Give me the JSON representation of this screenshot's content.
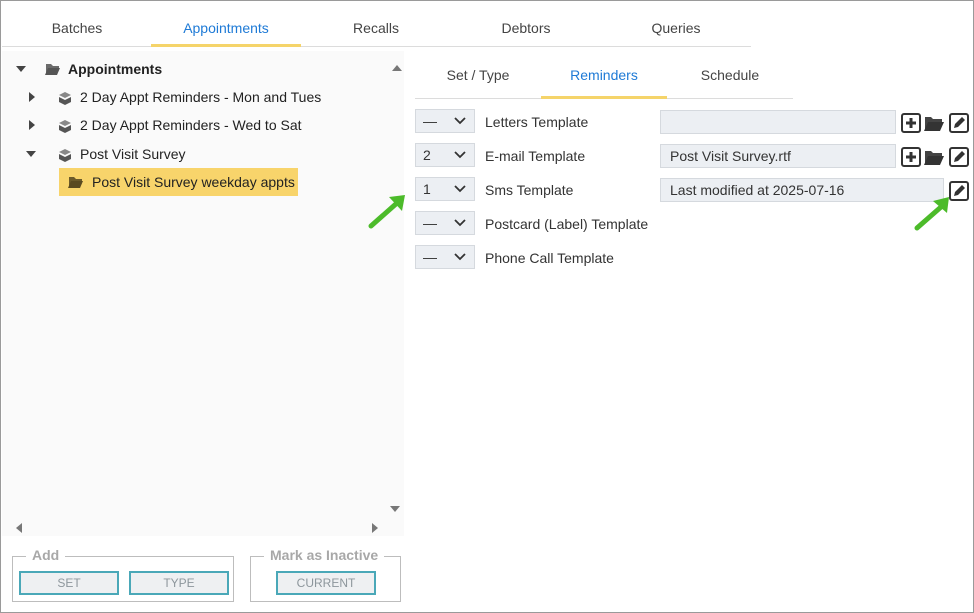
{
  "top_tabs": [
    "Batches",
    "Appointments",
    "Recalls",
    "Debtors",
    "Queries"
  ],
  "active_top_tab": "Appointments",
  "tree": {
    "root": "Appointments",
    "items": [
      {
        "label": "2 Day Appt Reminders - Mon and Tues",
        "expanded": false
      },
      {
        "label": "2 Day Appt Reminders - Wed to Sat",
        "expanded": false
      },
      {
        "label": "Post Visit Survey",
        "expanded": true
      }
    ],
    "selected_child": "Post Visit Survey weekday appts"
  },
  "add_group": {
    "legend": "Add",
    "set_label": "SET",
    "type_label": "TYPE"
  },
  "inactive_group": {
    "legend": "Mark as Inactive",
    "current_label": "CURRENT"
  },
  "sub_tabs": [
    "Set / Type",
    "Reminders",
    "Schedule"
  ],
  "active_sub_tab": "Reminders",
  "templates": [
    {
      "select": "—",
      "label": "Letters Template",
      "value": ""
    },
    {
      "select": "2",
      "label": "E-mail Template",
      "value": "Post Visit Survey.rtf"
    },
    {
      "select": "1",
      "label": "Sms Template",
      "value": "Last modified at 2025-07-16"
    },
    {
      "select": "—",
      "label": "Postcard (Label) Template"
    },
    {
      "select": "—",
      "label": "Phone Call Template"
    }
  ],
  "colors": {
    "accent": "#1e7ad6",
    "tab_underline": "#f5d46a",
    "selected": "#f8d46b",
    "annotation_arrow": "#4cbb2a"
  }
}
